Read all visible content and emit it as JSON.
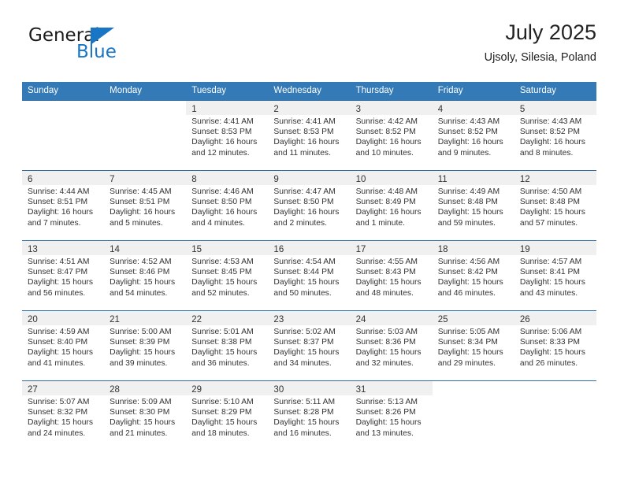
{
  "brand": {
    "name_top": "General",
    "name_bottom": "Blue",
    "accent_color": "#1976c4"
  },
  "header": {
    "title": "July 2025",
    "subtitle": "Ujsoly, Silesia, Poland"
  },
  "colors": {
    "header_row_background": "#337ab7",
    "header_row_text": "#ffffff",
    "row_divider": "#2e6da4",
    "day_band_background": "#f0f0f0",
    "cell_background": "#ffffff",
    "body_text": "#333333"
  },
  "weekdays": [
    "Sunday",
    "Monday",
    "Tuesday",
    "Wednesday",
    "Thursday",
    "Friday",
    "Saturday"
  ],
  "labels": {
    "sunrise": "Sunrise:",
    "sunset": "Sunset:",
    "daylight": "Daylight:"
  },
  "weeks": [
    [
      {
        "day": ""
      },
      {
        "day": ""
      },
      {
        "day": "1",
        "sunrise": "Sunrise: 4:41 AM",
        "sunset": "Sunset: 8:53 PM",
        "daylight_1": "Daylight: 16 hours",
        "daylight_2": "and 12 minutes."
      },
      {
        "day": "2",
        "sunrise": "Sunrise: 4:41 AM",
        "sunset": "Sunset: 8:53 PM",
        "daylight_1": "Daylight: 16 hours",
        "daylight_2": "and 11 minutes."
      },
      {
        "day": "3",
        "sunrise": "Sunrise: 4:42 AM",
        "sunset": "Sunset: 8:52 PM",
        "daylight_1": "Daylight: 16 hours",
        "daylight_2": "and 10 minutes."
      },
      {
        "day": "4",
        "sunrise": "Sunrise: 4:43 AM",
        "sunset": "Sunset: 8:52 PM",
        "daylight_1": "Daylight: 16 hours",
        "daylight_2": "and 9 minutes."
      },
      {
        "day": "5",
        "sunrise": "Sunrise: 4:43 AM",
        "sunset": "Sunset: 8:52 PM",
        "daylight_1": "Daylight: 16 hours",
        "daylight_2": "and 8 minutes."
      }
    ],
    [
      {
        "day": "6",
        "sunrise": "Sunrise: 4:44 AM",
        "sunset": "Sunset: 8:51 PM",
        "daylight_1": "Daylight: 16 hours",
        "daylight_2": "and 7 minutes."
      },
      {
        "day": "7",
        "sunrise": "Sunrise: 4:45 AM",
        "sunset": "Sunset: 8:51 PM",
        "daylight_1": "Daylight: 16 hours",
        "daylight_2": "and 5 minutes."
      },
      {
        "day": "8",
        "sunrise": "Sunrise: 4:46 AM",
        "sunset": "Sunset: 8:50 PM",
        "daylight_1": "Daylight: 16 hours",
        "daylight_2": "and 4 minutes."
      },
      {
        "day": "9",
        "sunrise": "Sunrise: 4:47 AM",
        "sunset": "Sunset: 8:50 PM",
        "daylight_1": "Daylight: 16 hours",
        "daylight_2": "and 2 minutes."
      },
      {
        "day": "10",
        "sunrise": "Sunrise: 4:48 AM",
        "sunset": "Sunset: 8:49 PM",
        "daylight_1": "Daylight: 16 hours",
        "daylight_2": "and 1 minute."
      },
      {
        "day": "11",
        "sunrise": "Sunrise: 4:49 AM",
        "sunset": "Sunset: 8:48 PM",
        "daylight_1": "Daylight: 15 hours",
        "daylight_2": "and 59 minutes."
      },
      {
        "day": "12",
        "sunrise": "Sunrise: 4:50 AM",
        "sunset": "Sunset: 8:48 PM",
        "daylight_1": "Daylight: 15 hours",
        "daylight_2": "and 57 minutes."
      }
    ],
    [
      {
        "day": "13",
        "sunrise": "Sunrise: 4:51 AM",
        "sunset": "Sunset: 8:47 PM",
        "daylight_1": "Daylight: 15 hours",
        "daylight_2": "and 56 minutes."
      },
      {
        "day": "14",
        "sunrise": "Sunrise: 4:52 AM",
        "sunset": "Sunset: 8:46 PM",
        "daylight_1": "Daylight: 15 hours",
        "daylight_2": "and 54 minutes."
      },
      {
        "day": "15",
        "sunrise": "Sunrise: 4:53 AM",
        "sunset": "Sunset: 8:45 PM",
        "daylight_1": "Daylight: 15 hours",
        "daylight_2": "and 52 minutes."
      },
      {
        "day": "16",
        "sunrise": "Sunrise: 4:54 AM",
        "sunset": "Sunset: 8:44 PM",
        "daylight_1": "Daylight: 15 hours",
        "daylight_2": "and 50 minutes."
      },
      {
        "day": "17",
        "sunrise": "Sunrise: 4:55 AM",
        "sunset": "Sunset: 8:43 PM",
        "daylight_1": "Daylight: 15 hours",
        "daylight_2": "and 48 minutes."
      },
      {
        "day": "18",
        "sunrise": "Sunrise: 4:56 AM",
        "sunset": "Sunset: 8:42 PM",
        "daylight_1": "Daylight: 15 hours",
        "daylight_2": "and 46 minutes."
      },
      {
        "day": "19",
        "sunrise": "Sunrise: 4:57 AM",
        "sunset": "Sunset: 8:41 PM",
        "daylight_1": "Daylight: 15 hours",
        "daylight_2": "and 43 minutes."
      }
    ],
    [
      {
        "day": "20",
        "sunrise": "Sunrise: 4:59 AM",
        "sunset": "Sunset: 8:40 PM",
        "daylight_1": "Daylight: 15 hours",
        "daylight_2": "and 41 minutes."
      },
      {
        "day": "21",
        "sunrise": "Sunrise: 5:00 AM",
        "sunset": "Sunset: 8:39 PM",
        "daylight_1": "Daylight: 15 hours",
        "daylight_2": "and 39 minutes."
      },
      {
        "day": "22",
        "sunrise": "Sunrise: 5:01 AM",
        "sunset": "Sunset: 8:38 PM",
        "daylight_1": "Daylight: 15 hours",
        "daylight_2": "and 36 minutes."
      },
      {
        "day": "23",
        "sunrise": "Sunrise: 5:02 AM",
        "sunset": "Sunset: 8:37 PM",
        "daylight_1": "Daylight: 15 hours",
        "daylight_2": "and 34 minutes."
      },
      {
        "day": "24",
        "sunrise": "Sunrise: 5:03 AM",
        "sunset": "Sunset: 8:36 PM",
        "daylight_1": "Daylight: 15 hours",
        "daylight_2": "and 32 minutes."
      },
      {
        "day": "25",
        "sunrise": "Sunrise: 5:05 AM",
        "sunset": "Sunset: 8:34 PM",
        "daylight_1": "Daylight: 15 hours",
        "daylight_2": "and 29 minutes."
      },
      {
        "day": "26",
        "sunrise": "Sunrise: 5:06 AM",
        "sunset": "Sunset: 8:33 PM",
        "daylight_1": "Daylight: 15 hours",
        "daylight_2": "and 26 minutes."
      }
    ],
    [
      {
        "day": "27",
        "sunrise": "Sunrise: 5:07 AM",
        "sunset": "Sunset: 8:32 PM",
        "daylight_1": "Daylight: 15 hours",
        "daylight_2": "and 24 minutes."
      },
      {
        "day": "28",
        "sunrise": "Sunrise: 5:09 AM",
        "sunset": "Sunset: 8:30 PM",
        "daylight_1": "Daylight: 15 hours",
        "daylight_2": "and 21 minutes."
      },
      {
        "day": "29",
        "sunrise": "Sunrise: 5:10 AM",
        "sunset": "Sunset: 8:29 PM",
        "daylight_1": "Daylight: 15 hours",
        "daylight_2": "and 18 minutes."
      },
      {
        "day": "30",
        "sunrise": "Sunrise: 5:11 AM",
        "sunset": "Sunset: 8:28 PM",
        "daylight_1": "Daylight: 15 hours",
        "daylight_2": "and 16 minutes."
      },
      {
        "day": "31",
        "sunrise": "Sunrise: 5:13 AM",
        "sunset": "Sunset: 8:26 PM",
        "daylight_1": "Daylight: 15 hours",
        "daylight_2": "and 13 minutes."
      },
      {
        "day": ""
      },
      {
        "day": ""
      }
    ]
  ]
}
